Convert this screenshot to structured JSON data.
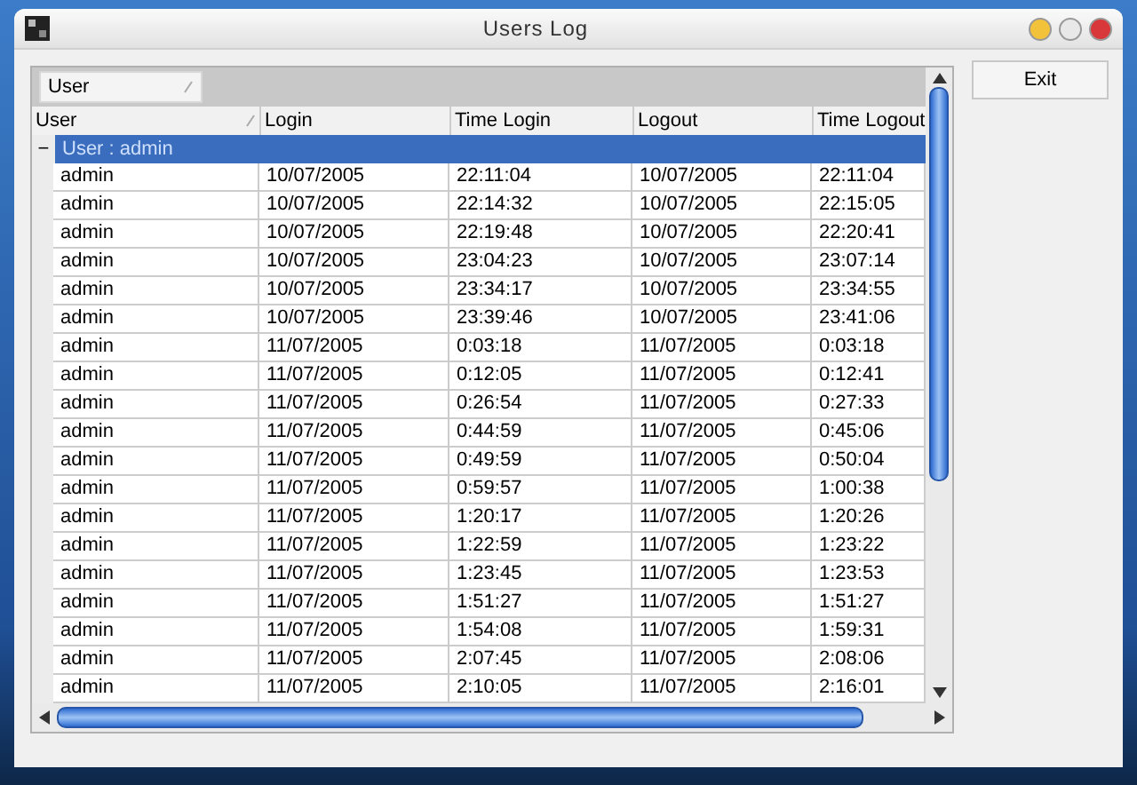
{
  "window": {
    "title": "Users Log"
  },
  "group_panel": {
    "chips": [
      {
        "label": "User",
        "sorted": true
      }
    ]
  },
  "columns": [
    {
      "label": "User",
      "sorted": true
    },
    {
      "label": "Login",
      "sorted": false
    },
    {
      "label": "Time Login",
      "sorted": false
    },
    {
      "label": "Logout",
      "sorted": false
    },
    {
      "label": "Time Logout",
      "sorted": false
    }
  ],
  "group": {
    "label": "User : admin",
    "expanded": true,
    "selected": true,
    "expander": "−",
    "rows": [
      [
        "admin",
        "10/07/2005",
        "22:11:04",
        "10/07/2005",
        "22:11:04"
      ],
      [
        "admin",
        "10/07/2005",
        "22:14:32",
        "10/07/2005",
        "22:15:05"
      ],
      [
        "admin",
        "10/07/2005",
        "22:19:48",
        "10/07/2005",
        "22:20:41"
      ],
      [
        "admin",
        "10/07/2005",
        "23:04:23",
        "10/07/2005",
        "23:07:14"
      ],
      [
        "admin",
        "10/07/2005",
        "23:34:17",
        "10/07/2005",
        "23:34:55"
      ],
      [
        "admin",
        "10/07/2005",
        "23:39:46",
        "10/07/2005",
        "23:41:06"
      ],
      [
        "admin",
        "11/07/2005",
        "0:03:18",
        "11/07/2005",
        "0:03:18"
      ],
      [
        "admin",
        "11/07/2005",
        "0:12:05",
        "11/07/2005",
        "0:12:41"
      ],
      [
        "admin",
        "11/07/2005",
        "0:26:54",
        "11/07/2005",
        "0:27:33"
      ],
      [
        "admin",
        "11/07/2005",
        "0:44:59",
        "11/07/2005",
        "0:45:06"
      ],
      [
        "admin",
        "11/07/2005",
        "0:49:59",
        "11/07/2005",
        "0:50:04"
      ],
      [
        "admin",
        "11/07/2005",
        "0:59:57",
        "11/07/2005",
        "1:00:38"
      ],
      [
        "admin",
        "11/07/2005",
        "1:20:17",
        "11/07/2005",
        "1:20:26"
      ],
      [
        "admin",
        "11/07/2005",
        "1:22:59",
        "11/07/2005",
        "1:23:22"
      ],
      [
        "admin",
        "11/07/2005",
        "1:23:45",
        "11/07/2005",
        "1:23:53"
      ],
      [
        "admin",
        "11/07/2005",
        "1:51:27",
        "11/07/2005",
        "1:51:27"
      ],
      [
        "admin",
        "11/07/2005",
        "1:54:08",
        "11/07/2005",
        "1:59:31"
      ],
      [
        "admin",
        "11/07/2005",
        "2:07:45",
        "11/07/2005",
        "2:08:06"
      ],
      [
        "admin",
        "11/07/2005",
        "2:10:05",
        "11/07/2005",
        "2:16:01"
      ]
    ]
  },
  "buttons": [
    {
      "label": "Exit"
    }
  ]
}
